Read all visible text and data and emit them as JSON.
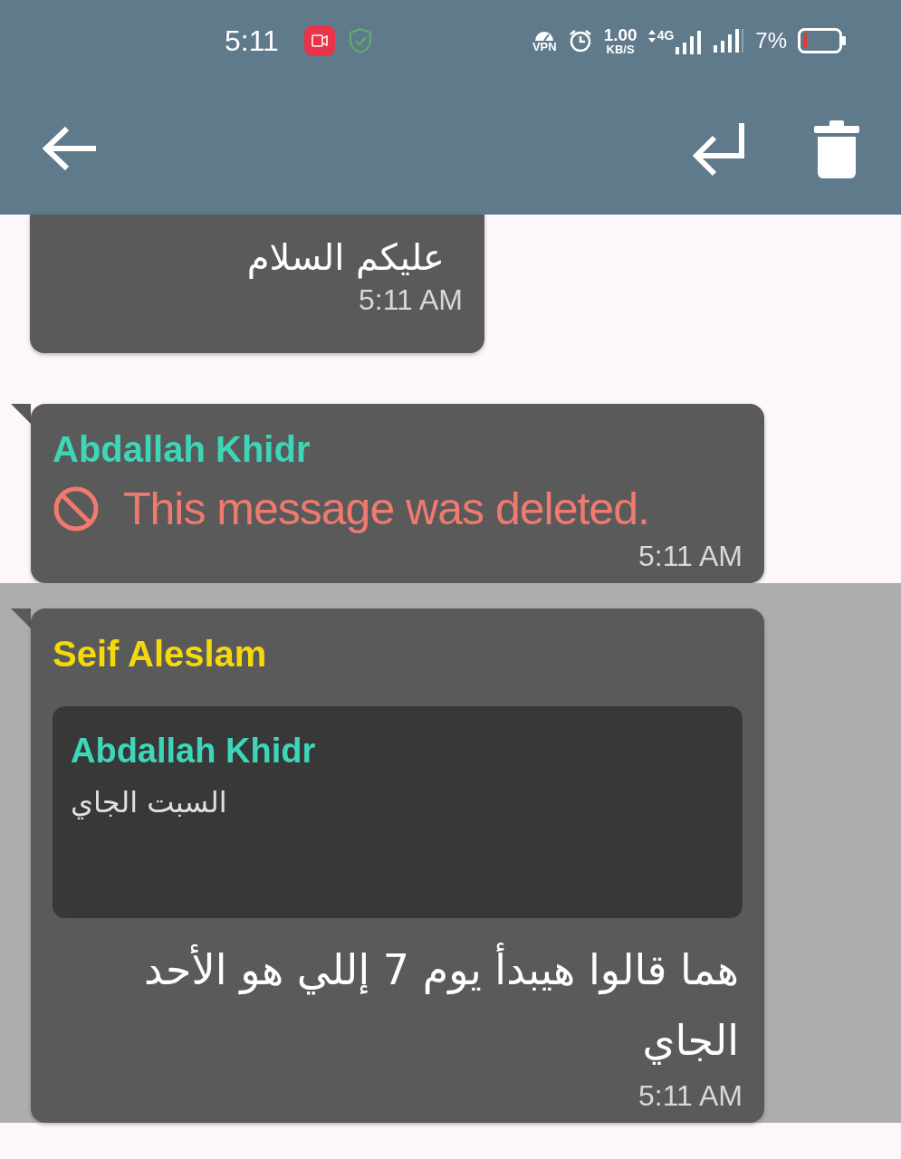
{
  "status_bar": {
    "time": "5:11",
    "vpn": "VPN",
    "speed_value": "1.00",
    "speed_unit": "KB/S",
    "network": "4G",
    "battery": "7%"
  },
  "messages": [
    {
      "kind": "text",
      "selected": false,
      "continued": true,
      "text": "عليكم السلام",
      "time": "5:11 AM"
    },
    {
      "kind": "deleted",
      "selected": false,
      "continued": false,
      "sender": {
        "name": "Abdallah Khidr",
        "color": "#3dd6b8"
      },
      "text": "This message was deleted.",
      "time": "5:11 AM"
    },
    {
      "kind": "text",
      "selected": true,
      "continued": false,
      "sender": {
        "name": "Seif Aleslam",
        "color": "#f5d90a"
      },
      "reply": {
        "sender": {
          "name": "Abdallah Khidr",
          "color": "#3dd6b8"
        },
        "text": "السبت الجاي"
      },
      "text": "هما قالوا هيبدأ يوم 7 إللي هو الأحد الجاي",
      "time": "5:11 AM"
    }
  ]
}
